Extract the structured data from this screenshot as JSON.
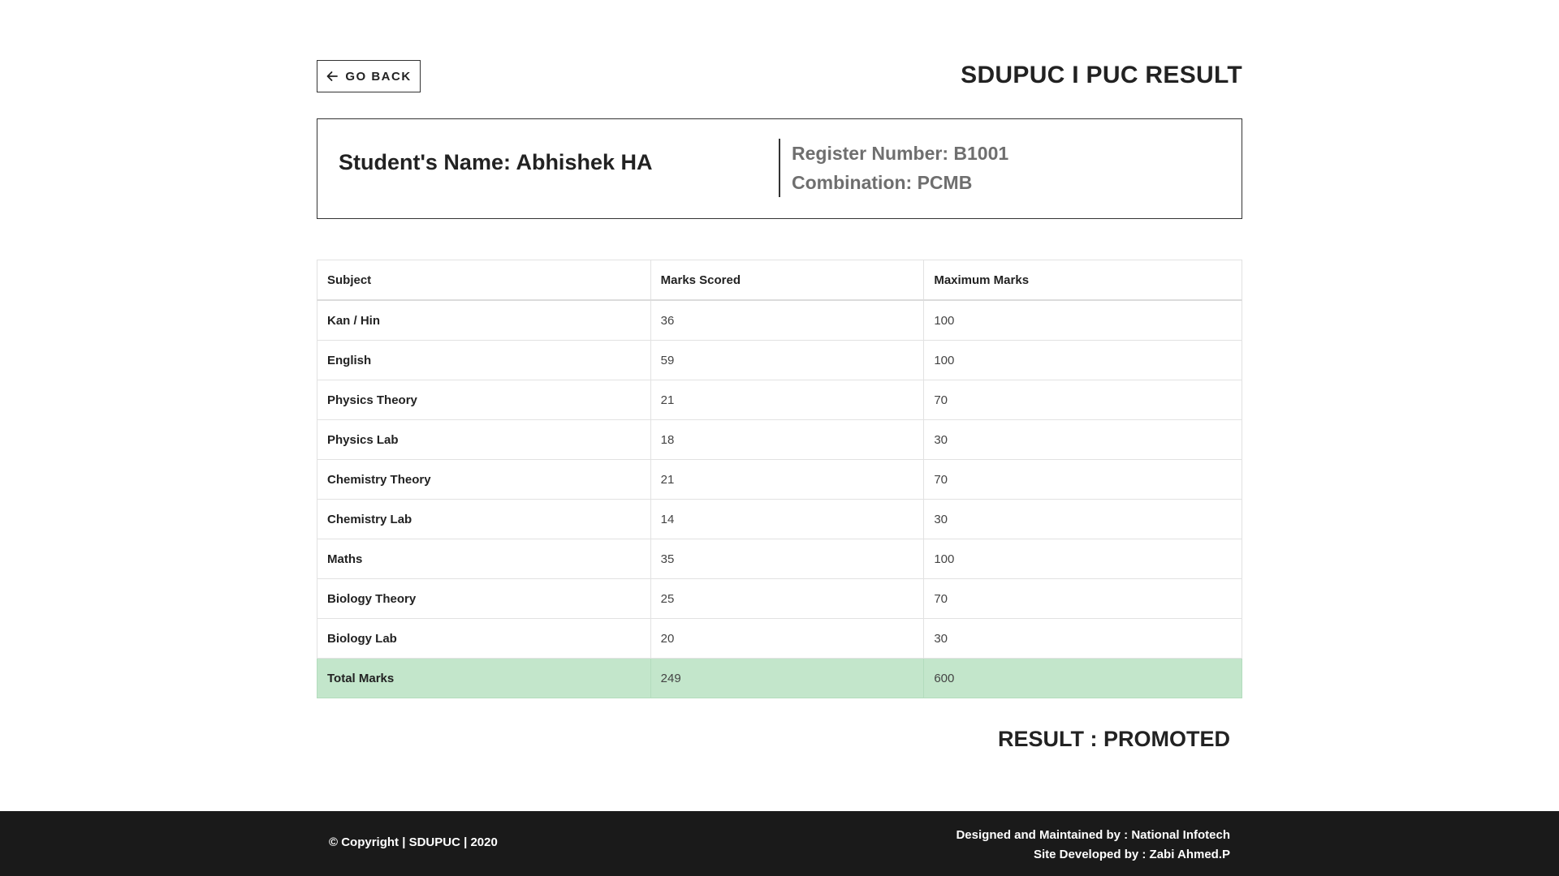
{
  "header": {
    "back_label": "GO BACK",
    "title": "SDUPUC I PUC RESULT"
  },
  "student": {
    "name_line": "Student's Name: Abhishek HA",
    "register_line": "Register Number: B1001",
    "combination_line": "Combination: PCMB"
  },
  "table": {
    "headers": [
      "Subject",
      "Marks Scored",
      "Maximum Marks"
    ],
    "rows": [
      {
        "subject": "Kan / Hin",
        "scored": "36",
        "max": "100"
      },
      {
        "subject": "English",
        "scored": "59",
        "max": "100"
      },
      {
        "subject": "Physics Theory",
        "scored": "21",
        "max": "70"
      },
      {
        "subject": "Physics Lab",
        "scored": "18",
        "max": "30"
      },
      {
        "subject": "Chemistry Theory",
        "scored": "21",
        "max": "70"
      },
      {
        "subject": "Chemistry Lab",
        "scored": "14",
        "max": "30"
      },
      {
        "subject": "Maths",
        "scored": "35",
        "max": "100"
      },
      {
        "subject": "Biology Theory",
        "scored": "25",
        "max": "70"
      },
      {
        "subject": "Biology Lab",
        "scored": "20",
        "max": "30"
      }
    ],
    "total": {
      "subject": "Total Marks",
      "scored": "249",
      "max": "600"
    },
    "total_row_color": "#c3e6cb"
  },
  "result": {
    "text": "RESULT : PROMOTED"
  },
  "footer": {
    "copyright": "© Copyright | SDUPUC | 2020",
    "designed_by": "Designed and Maintained by : National Infotech",
    "developed_by": "Site Developed by : Zabi Ahmed.P",
    "background_color": "#1a1a1a"
  },
  "icons": {
    "back": "arrow-left-icon"
  }
}
